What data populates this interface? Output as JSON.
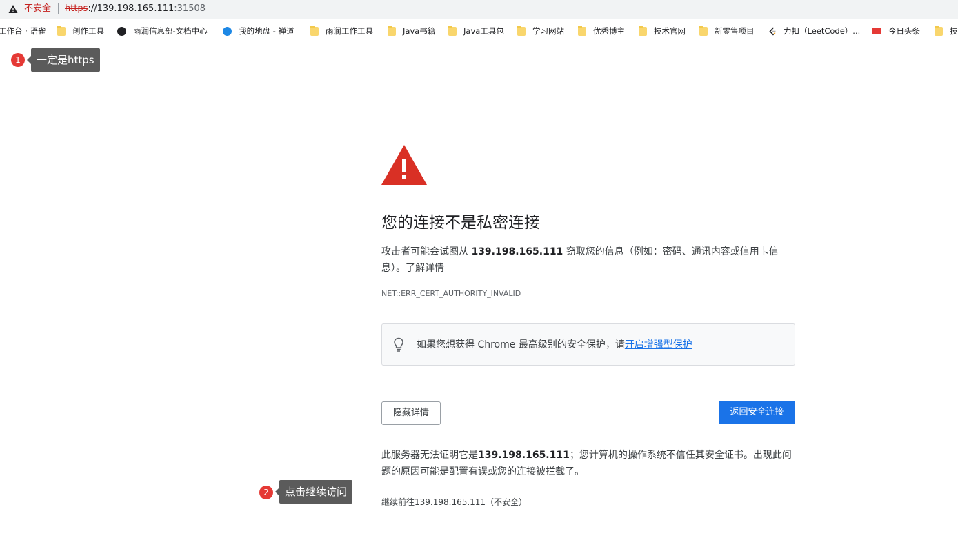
{
  "address_bar": {
    "status_text": "不安全",
    "url_scheme": "https",
    "url_sep": "://",
    "url_host": "139.198.165.111",
    "url_port": ":31508"
  },
  "bookmarks": [
    {
      "label": "工作台 · 语雀",
      "icon": "none"
    },
    {
      "label": "创作工具",
      "icon": "folder-icon"
    },
    {
      "label": "雨润信息部-文档中心",
      "icon": "globe-icon"
    },
    {
      "label": "我的地盘 - 禅道",
      "icon": "zentao-icon"
    },
    {
      "label": "雨润工作工具",
      "icon": "folder-icon"
    },
    {
      "label": "Java书籍",
      "icon": "folder-icon"
    },
    {
      "label": "Java工具包",
      "icon": "folder-icon"
    },
    {
      "label": "学习网站",
      "icon": "folder-icon"
    },
    {
      "label": "优秀博主",
      "icon": "folder-icon"
    },
    {
      "label": "技术官网",
      "icon": "folder-icon"
    },
    {
      "label": "新零售项目",
      "icon": "folder-icon"
    },
    {
      "label": "力扣（LeetCode）...",
      "icon": "leetcode-icon"
    },
    {
      "label": "今日头条",
      "icon": "toutiao-icon"
    },
    {
      "label": "技",
      "icon": "folder-icon"
    }
  ],
  "annotations": [
    {
      "number": "1",
      "text": "一定是https"
    },
    {
      "number": "2",
      "text": "点击继续访问"
    }
  ],
  "interstitial": {
    "heading": "您的连接不是私密连接",
    "desc_before": "攻击者可能会试图从 ",
    "desc_host": "139.198.165.111",
    "desc_after": " 窃取您的信息（例如：密码、通讯内容或信用卡信息）。",
    "learn_more": "了解详情",
    "error_code": "NET::ERR_CERT_AUTHORITY_INVALID",
    "tip_text": "如果您想获得 Chrome 最高级别的安全保护，请",
    "tip_link": "开启增强型保护",
    "hide_details_label": "隐藏详情",
    "back_to_safety_label": "返回安全连接",
    "detail_before": "此服务器无法证明它是",
    "detail_host": "139.198.165.111",
    "detail_after": "；您计算机的操作系统不信任其安全证书。出现此问题的原因可能是配置有误或您的连接被拦截了。",
    "proceed_link": "继续前往139.198.165.111（不安全）"
  },
  "colors": {
    "accent_blue": "#1a73e8",
    "danger_red": "#d93025",
    "annotation_red": "#e53935",
    "tooltip_gray": "#5b5b5b"
  }
}
